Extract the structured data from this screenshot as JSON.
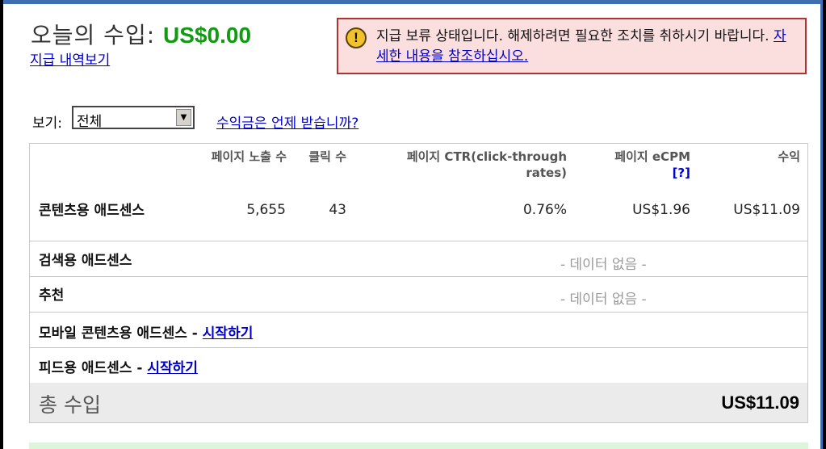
{
  "colors": {
    "frame_blue": "#3f6fb0",
    "earnings_green": "#139a13",
    "alert_bg": "#fbdede",
    "alert_border": "#b03333",
    "link": "#0000cc",
    "total_bg": "#ebebeb"
  },
  "earnings": {
    "title": "오늘의 수입:",
    "amount": "US$0.00",
    "history_link": "지급 내역보기"
  },
  "alert": {
    "icon": "exclamation-icon",
    "icon_glyph": "!",
    "message": "지급 보류 상태입니다. 해제하려면 필요한 조치를 취하시기 바랍니다.",
    "link": "자세한 내용을 참조하십시오."
  },
  "view": {
    "label": "보기:",
    "selected": "전체",
    "dropdown_glyph": "▼"
  },
  "when_link": "수익금은 언제 받습니까?",
  "table": {
    "headers": {
      "impressions": "페이지 노출 수",
      "clicks": "클릭 수",
      "ctr": "페이지 CTR(click-through rates)",
      "ecpm": "페이지 eCPM",
      "ecpm_help": "[?]",
      "earnings": "수익"
    },
    "rows": [
      {
        "name": "콘텐츠용 애드센스",
        "impressions": "5,655",
        "clicks": "43",
        "ctr": "0.76%",
        "ecpm": "US$1.96",
        "earnings": "US$11.09"
      },
      {
        "name": "검색용 애드센스",
        "nodata": "- 데이터 없음 -"
      },
      {
        "name": "추천",
        "nodata": "- 데이터 없음 -"
      },
      {
        "name": "모바일 콘텐츠용 애드센스",
        "sep": " - ",
        "link": "시작하기"
      },
      {
        "name": "피드용 애드센스",
        "sep": " - ",
        "link": "시작하기"
      }
    ],
    "total": {
      "label": "총 수입",
      "value": "US$11.09"
    }
  }
}
